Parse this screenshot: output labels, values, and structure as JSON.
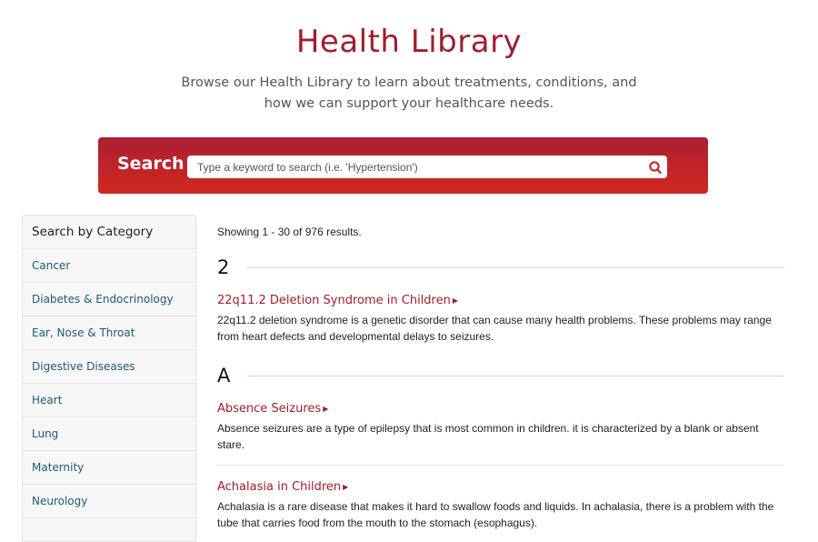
{
  "header": {
    "title": "Health Library",
    "subtitle_line1": "Browse our Health Library to learn about treatments, conditions, and",
    "subtitle_line2": "how we can support your healthcare needs."
  },
  "search": {
    "label": "Search",
    "placeholder": "Type a keyword to search (i.e. 'Hypertension')",
    "value": "",
    "icon": "search-icon",
    "band_colors": [
      "#a91f34",
      "#d1281f"
    ]
  },
  "sidebar": {
    "heading": "Search by Category",
    "items": [
      {
        "label": "Cancer"
      },
      {
        "label": "Diabetes & Endocrinology"
      },
      {
        "label": "Ear, Nose & Throat"
      },
      {
        "label": "Digestive Diseases"
      },
      {
        "label": "Heart"
      },
      {
        "label": "Lung"
      },
      {
        "label": "Maternity"
      },
      {
        "label": "Neurology"
      }
    ]
  },
  "results": {
    "count_text": "Showing 1 - 30 of 976 results.",
    "groups": [
      {
        "letter": "2",
        "entries": [
          {
            "title": "22q11.2 Deletion Syndrome in Children",
            "description": "22q11.2 deletion syndrome is a genetic disorder that can cause many health problems. These problems may range from heart defects and developmental delays to seizures."
          }
        ]
      },
      {
        "letter": "A",
        "entries": [
          {
            "title": "Absence Seizures",
            "description": "Absence seizures are a type of epilepsy that is most common in children. it is characterized by a blank or absent stare."
          },
          {
            "title": "Achalasia in Children",
            "description": "Achalasia is a rare disease that makes it hard to swallow foods and liquids. In achalasia, there is a problem with the tube that carries food from the mouth to the stomach (esophagus)."
          }
        ]
      }
    ]
  },
  "colors": {
    "brand": "#a11d2c",
    "category_link": "#1e5a78"
  }
}
